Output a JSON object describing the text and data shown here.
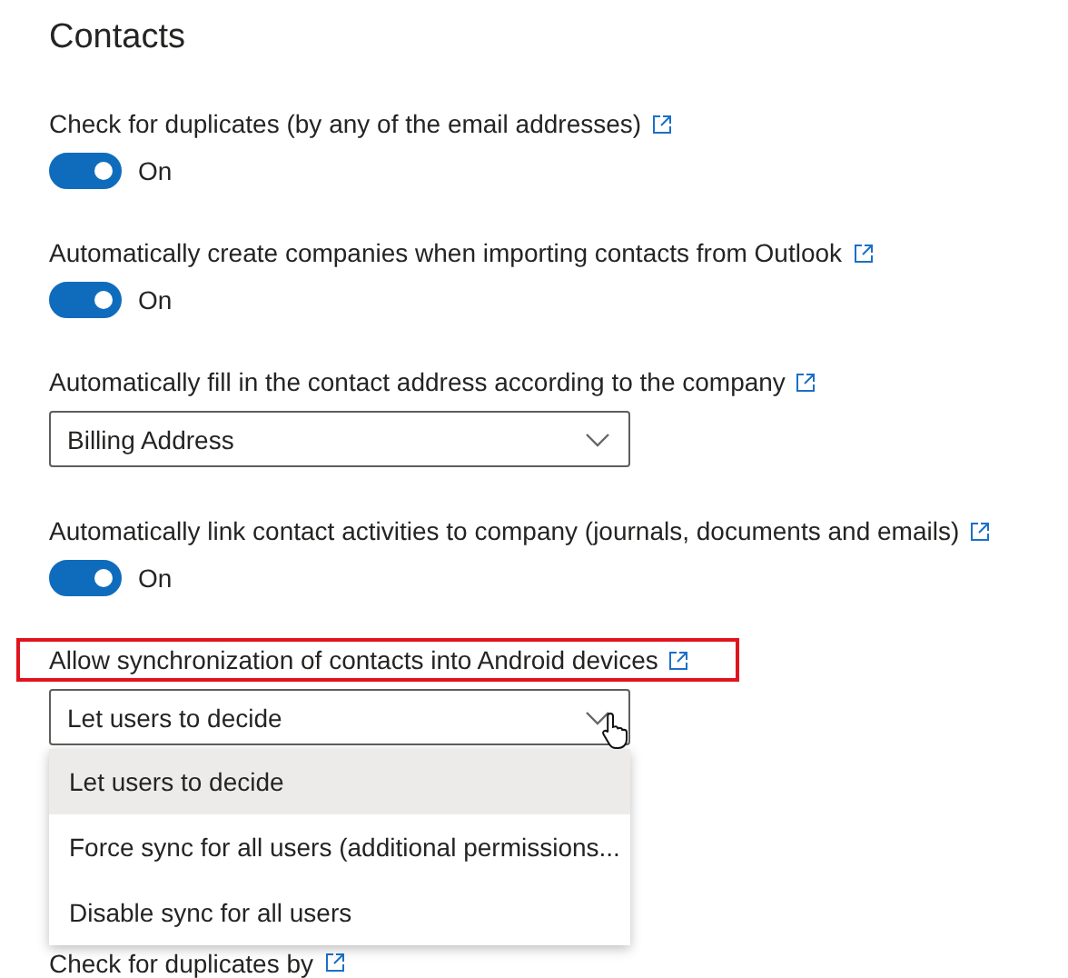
{
  "title": "Contacts",
  "settings": [
    {
      "kind": "toggle",
      "label": "Check for duplicates (by any of the email addresses)",
      "on": true,
      "state_text": "On",
      "highlighted": false
    },
    {
      "kind": "toggle",
      "label": "Automatically create companies when importing contacts from Outlook",
      "on": true,
      "state_text": "On",
      "highlighted": false
    },
    {
      "kind": "dropdown",
      "label": "Automatically fill in the contact address according to the company",
      "value": "Billing Address",
      "expanded": false,
      "highlighted": false
    },
    {
      "kind": "toggle",
      "label": "Automatically link contact activities to company (journals, documents and emails)",
      "on": true,
      "state_text": "On",
      "highlighted": false
    },
    {
      "kind": "dropdown",
      "label": "Allow synchronization of contacts into Android devices",
      "value": "Let users to decide",
      "expanded": true,
      "highlighted": true,
      "options": [
        {
          "label": "Let users to decide",
          "selected": true
        },
        {
          "label": "Force sync for all users (additional permissions...",
          "selected": false
        },
        {
          "label": "Disable sync for all users",
          "selected": false
        }
      ]
    },
    {
      "kind": "heading_only",
      "label": "Check for duplicates by",
      "highlighted": false
    }
  ]
}
